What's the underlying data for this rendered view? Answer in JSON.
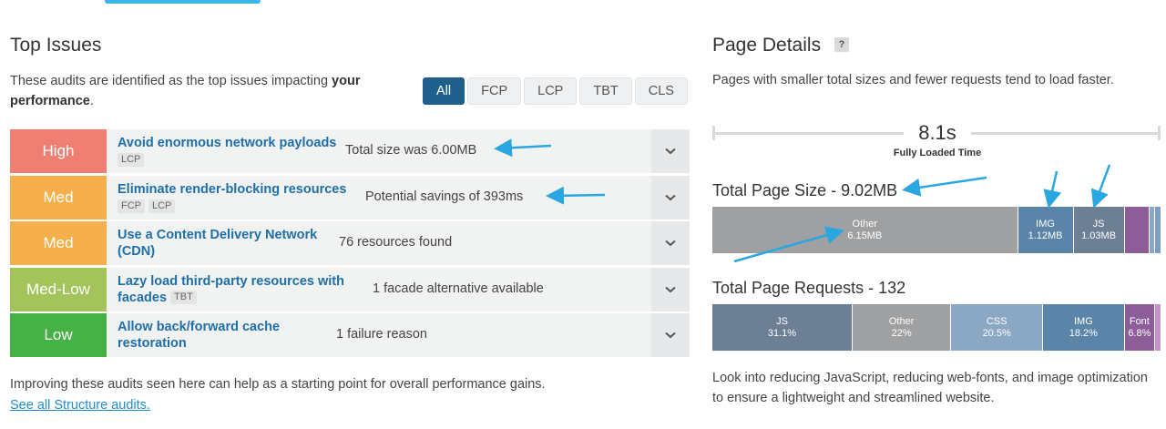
{
  "top_issues": {
    "title": "Top Issues",
    "intro_prefix": "These audits are identified as the top issues impacting ",
    "intro_bold": "your performance",
    "intro_suffix": ".",
    "filters": [
      "All",
      "FCP",
      "LCP",
      "TBT",
      "CLS"
    ],
    "active_filter": "All",
    "issues": [
      {
        "severity": "High",
        "title": "Avoid enormous network payloads",
        "tags": [
          "LCP"
        ],
        "detail": "Total size was 6.00MB"
      },
      {
        "severity": "Med",
        "title": "Eliminate render-blocking resources",
        "tags": [
          "FCP",
          "LCP"
        ],
        "detail": "Potential savings of 393ms"
      },
      {
        "severity": "Med",
        "title": "Use a Content Delivery Network (CDN)",
        "tags": [],
        "detail": "76 resources found"
      },
      {
        "severity": "Med-Low",
        "title": "Lazy load third-party resources with facades",
        "tags": [
          "TBT"
        ],
        "detail": "1 facade alternative available"
      },
      {
        "severity": "Low",
        "title": "Allow back/forward cache restoration",
        "tags": [],
        "detail": "1 failure reason"
      }
    ],
    "footer_text": "Improving these audits seen here can help as a starting point for overall performance gains.",
    "footer_link": "See all Structure audits."
  },
  "page_details": {
    "title": "Page Details",
    "help_icon": "?",
    "intro": "Pages with smaller total sizes and fewer requests tend to load faster.",
    "fully_loaded_value": "8.1s",
    "fully_loaded_label": "Fully Loaded Time",
    "size_title": "Total Page Size - 9.02MB",
    "size_segments": [
      {
        "name": "Other",
        "value": "6.15MB",
        "share": 0.68,
        "color": "#9fa0a2"
      },
      {
        "name": "IMG",
        "value": "1.12MB",
        "share": 0.124,
        "color": "#5a84a8"
      },
      {
        "name": "JS",
        "value": "1.03MB",
        "share": 0.114,
        "color": "#6d7f94"
      },
      {
        "name": "",
        "value": "",
        "share": 0.056,
        "color": "#8d5d9a"
      },
      {
        "name": "",
        "value": "",
        "share": 0.012,
        "color": "#8aa8c4"
      },
      {
        "name": "",
        "value": "",
        "share": 0.014,
        "color": "#7d9ec0"
      }
    ],
    "requests_title": "Total Page Requests - 132",
    "request_segments": [
      {
        "name": "JS",
        "value": "31.1%",
        "share": 0.311,
        "color": "#6d7f94"
      },
      {
        "name": "Other",
        "value": "22%",
        "share": 0.22,
        "color": "#9fa0a2"
      },
      {
        "name": "CSS",
        "value": "20.5%",
        "share": 0.205,
        "color": "#8aa8c4"
      },
      {
        "name": "IMG",
        "value": "18.2%",
        "share": 0.182,
        "color": "#5a84a8"
      },
      {
        "name": "Font",
        "value": "6.8%",
        "share": 0.068,
        "color": "#8d5d9a"
      },
      {
        "name": "",
        "value": "",
        "share": 0.014,
        "color": "#c991c9"
      }
    ],
    "bottom_note": "Look into reducing JavaScript, reducing web-fonts, and image optimization to ensure a lightweight and streamlined website."
  },
  "colors": {
    "accent": "#3fb6e8",
    "link": "#1f6fa8",
    "active_filter": "#1f5f8b",
    "high": "#ef7f73",
    "med": "#f5b04b",
    "med_low": "#a2c45a",
    "low": "#46b246"
  },
  "icons": {
    "expand": "chevron-down-icon",
    "help": "help-icon",
    "annotation": "arrow-annotation"
  }
}
